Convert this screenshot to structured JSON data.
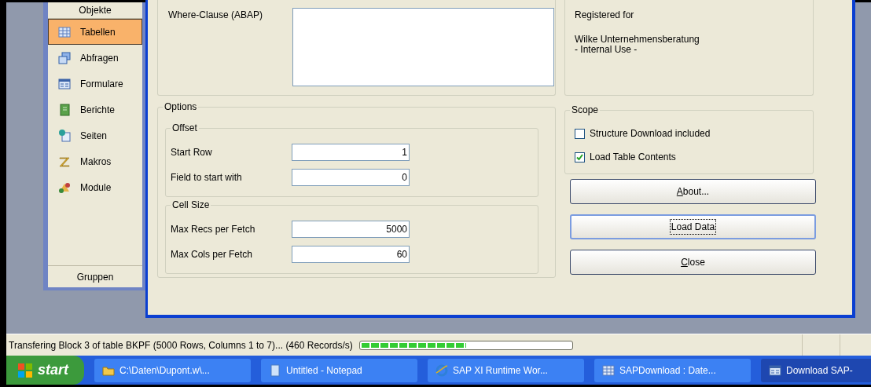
{
  "sidebar": {
    "header": "Objekte",
    "footer": "Gruppen",
    "items": [
      {
        "label": "Tabellen",
        "kind": "table",
        "selected": true
      },
      {
        "label": "Abfragen",
        "kind": "query",
        "selected": false
      },
      {
        "label": "Formulare",
        "kind": "form",
        "selected": false
      },
      {
        "label": "Berichte",
        "kind": "report",
        "selected": false
      },
      {
        "label": "Seiten",
        "kind": "page",
        "selected": false
      },
      {
        "label": "Makros",
        "kind": "macro",
        "selected": false
      },
      {
        "label": "Module",
        "kind": "module",
        "selected": false
      }
    ]
  },
  "dialog": {
    "where_clause": {
      "label": "Where-Clause (ABAP)"
    },
    "registration": {
      "title": "Registered for",
      "name": "Wilke Unternehmensberatung",
      "note": "- Internal Use -"
    },
    "options": {
      "title": "Options",
      "groups": [
        {
          "title": "Offset",
          "fields": [
            {
              "label": "Start Row",
              "value": "1"
            },
            {
              "label": "Field to start with",
              "value": "0"
            }
          ]
        },
        {
          "title": "Cell Size",
          "fields": [
            {
              "label": "Max Recs per Fetch",
              "value": "5000"
            },
            {
              "label": "Max Cols per Fetch",
              "value": "60"
            }
          ]
        }
      ]
    },
    "scope": {
      "title": "Scope",
      "checkboxes": [
        {
          "label": "Structure Download included",
          "checked": false
        },
        {
          "label": "Load Table Contents",
          "checked": true
        }
      ]
    },
    "buttons": [
      {
        "label": "About...",
        "underline_first": true,
        "focused": false
      },
      {
        "label": "Load Data",
        "underline_first": false,
        "focused": true
      },
      {
        "label": "Close",
        "underline_first": true,
        "focused": false
      }
    ]
  },
  "status_bar": {
    "text": "Transfering Block 3 of table BKPF (5000 Rows, Columns 1 to 7)... (460 Records/s)",
    "progress": {
      "level": 0.5
    }
  },
  "taskbar": {
    "start": "start",
    "tasks": [
      {
        "label": "C:\\Daten\\Dupont.w\\...",
        "kind": "folder",
        "selected": false
      },
      {
        "label": "Untitled - Notepad",
        "kind": "notepad",
        "selected": false
      },
      {
        "label": "SAP XI Runtime Wor...",
        "kind": "browser",
        "selected": false
      },
      {
        "label": "SAPDownload : Date...",
        "kind": "table",
        "selected": false
      },
      {
        "label": "Download SAP-",
        "kind": "form",
        "selected": true
      }
    ]
  }
}
